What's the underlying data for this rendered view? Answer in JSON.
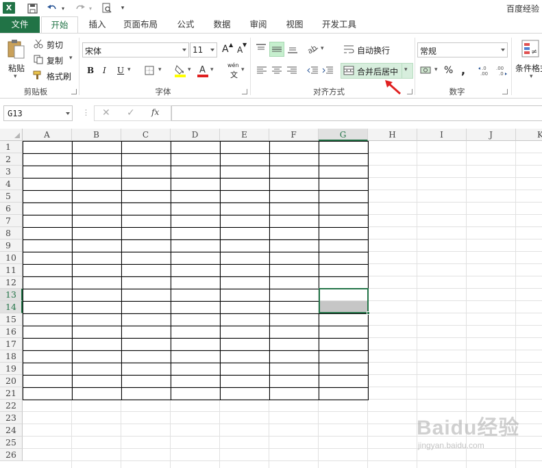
{
  "window": {
    "title": "百度经验"
  },
  "tabs": [
    "文件",
    "开始",
    "插入",
    "页面布局",
    "公式",
    "数据",
    "审阅",
    "视图",
    "开发工具"
  ],
  "ribbon": {
    "clipboard": {
      "paste": "粘贴",
      "cut": "剪切",
      "copy": "复制",
      "format_painter": "格式刷",
      "label": "剪贴板"
    },
    "font": {
      "name": "宋体",
      "size": "11",
      "grow": "A",
      "shrink": "A",
      "bold": "B",
      "italic": "I",
      "underline": "U",
      "wen": "wén",
      "wen_char": "文",
      "label": "字体"
    },
    "alignment": {
      "wrap_text": "自动换行",
      "merge_center": "合并后居中",
      "label": "对齐方式"
    },
    "number": {
      "format": "常规",
      "percent": "%",
      "comma": ",",
      "inc_decimal": "←.0 .00",
      "dec_decimal": ".00 →.0",
      "label": "数字"
    },
    "styles": {
      "conditional_format": "条件格式"
    }
  },
  "formula_bar": {
    "name_box": "G13",
    "fx": "fx",
    "cancel": "✕",
    "enter": "✓",
    "content": ""
  },
  "columns": [
    "A",
    "B",
    "C",
    "D",
    "E",
    "F",
    "G",
    "H",
    "I",
    "J",
    "K"
  ],
  "rows": [
    "1",
    "2",
    "3",
    "4",
    "5",
    "6",
    "7",
    "8",
    "9",
    "10",
    "11",
    "12",
    "13",
    "14",
    "15",
    "16",
    "17",
    "18",
    "19",
    "20",
    "21",
    "22",
    "23",
    "24",
    "25",
    "26"
  ],
  "selection": {
    "column": "G",
    "rows": [
      "13",
      "14"
    ]
  },
  "colors": {
    "accent": "#217346",
    "arrow": "#e02020",
    "selection_fill": "#c6c6c6"
  },
  "watermark": {
    "logo": "Baidu经验",
    "url": "jingyan.baidu.com"
  }
}
